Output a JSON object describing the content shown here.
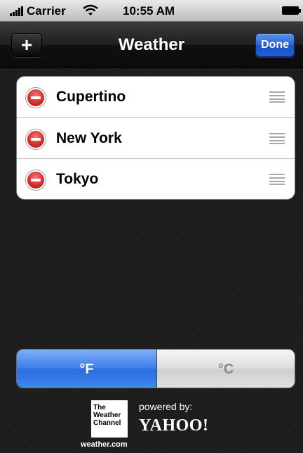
{
  "status_bar": {
    "carrier": "Carrier",
    "time": "10:55 AM"
  },
  "nav_bar": {
    "add_label": "+",
    "title": "Weather",
    "done_label": "Done"
  },
  "cities": [
    {
      "name": "Cupertino"
    },
    {
      "name": "New York"
    },
    {
      "name": "Tokyo"
    }
  ],
  "units": {
    "fahrenheit": "°F",
    "celsius": "°C",
    "selected": "°F"
  },
  "footer": {
    "twc_logo_lines": [
      "The",
      "Weather",
      "Channel"
    ],
    "twc_domain": "weather.com",
    "powered_by": "powered by:",
    "yahoo": "YAHOO!"
  },
  "colors": {
    "done_blue": "#2a63d6",
    "selected_segment": "#3a7ce9",
    "delete_red": "#d22a2a"
  },
  "icons": {
    "signal": "signal-bars-icon",
    "wifi": "wifi-icon",
    "battery": "battery-icon",
    "delete": "minus-circle-icon",
    "reorder": "reorder-handle-icon"
  }
}
